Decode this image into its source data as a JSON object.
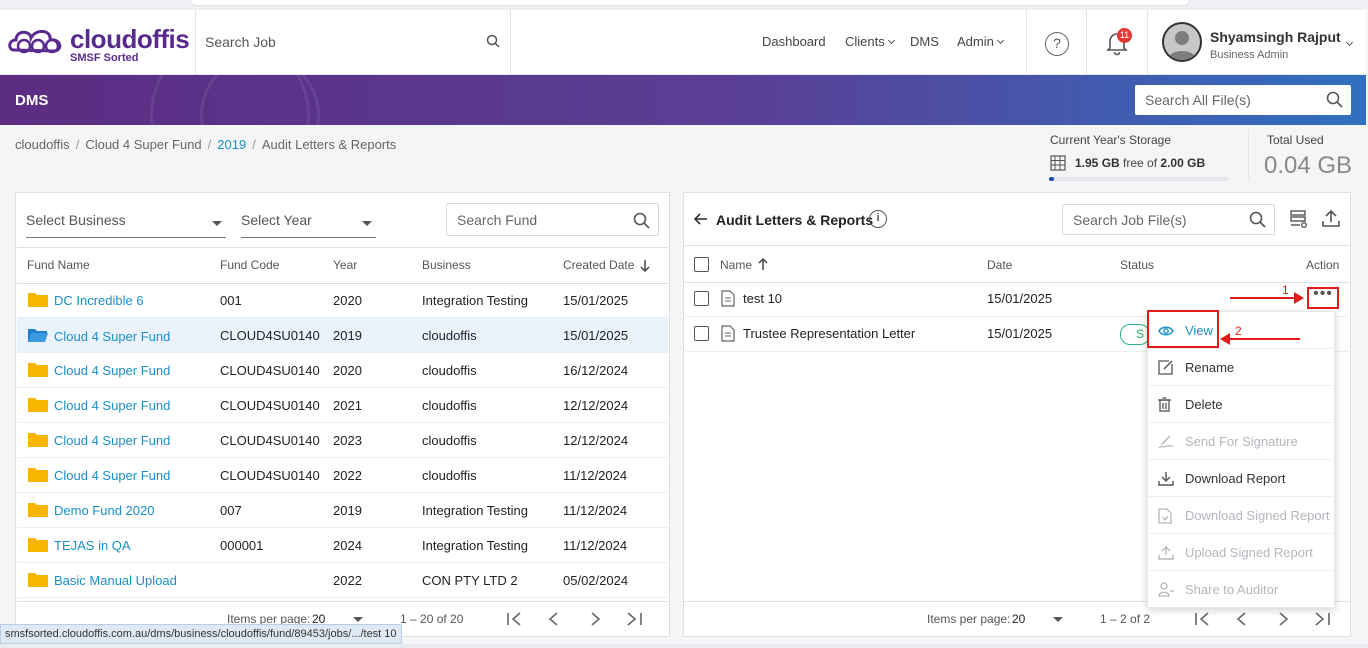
{
  "brand": {
    "name": "cloudoffis",
    "tagline": "SMSF Sorted",
    "color": "#5a2b8e"
  },
  "header": {
    "search_placeholder": "Search Job",
    "nav": [
      "Dashboard",
      "Clients",
      "DMS",
      "Admin"
    ],
    "notifications_count": "11",
    "user": {
      "name": "Shyamsingh Rajput",
      "role": "Business Admin"
    }
  },
  "banner": {
    "title": "DMS",
    "search_placeholder": "Search All File(s)"
  },
  "breadcrumb": [
    "cloudoffis",
    "Cloud 4 Super Fund",
    "2019",
    "Audit Letters & Reports"
  ],
  "storage": {
    "label": "Current Year's Storage",
    "free": "1.95 GB",
    "free_of": "free of",
    "total": "2.00 GB",
    "used_fraction": 0.025,
    "total_used_label": "Total Used",
    "total_used": "0.04 GB"
  },
  "left_panel": {
    "select_business": "Select Business",
    "select_year": "Select Year",
    "search_fund_placeholder": "Search Fund",
    "columns": [
      "Fund Name",
      "Fund Code",
      "Year",
      "Business",
      "Created Date"
    ],
    "rows": [
      {
        "name": "DC Incredible 6",
        "code": "001",
        "year": "2020",
        "business": "Integration Testing",
        "date": "15/01/2025"
      },
      {
        "name": "Cloud 4 Super Fund",
        "code": "CLOUD4SU0140",
        "year": "2019",
        "business": "cloudoffis",
        "date": "15/01/2025"
      },
      {
        "name": "Cloud 4 Super Fund",
        "code": "CLOUD4SU0140",
        "year": "2020",
        "business": "cloudoffis",
        "date": "16/12/2024"
      },
      {
        "name": "Cloud 4 Super Fund",
        "code": "CLOUD4SU0140",
        "year": "2021",
        "business": "cloudoffis",
        "date": "12/12/2024"
      },
      {
        "name": "Cloud 4 Super Fund",
        "code": "CLOUD4SU0140",
        "year": "2023",
        "business": "cloudoffis",
        "date": "12/12/2024"
      },
      {
        "name": "Cloud 4 Super Fund",
        "code": "CLOUD4SU0140",
        "year": "2022",
        "business": "cloudoffis",
        "date": "11/12/2024"
      },
      {
        "name": "Demo Fund 2020",
        "code": "007",
        "year": "2019",
        "business": "Integration Testing",
        "date": "11/12/2024"
      },
      {
        "name": "TEJAS in QA",
        "code": "000001",
        "year": "2024",
        "business": "Integration Testing",
        "date": "11/12/2024"
      },
      {
        "name": "Basic Manual Upload",
        "code": "",
        "year": "2022",
        "business": "CON PTY LTD 2",
        "date": "05/02/2024"
      }
    ],
    "pager": {
      "items_label": "Items per page:",
      "per_page": "20",
      "range": "1 – 20 of 20"
    }
  },
  "right_panel": {
    "title": "Audit Letters & Reports",
    "search_placeholder": "Search Job File(s)",
    "columns": [
      "Name",
      "Date",
      "Status",
      "Action"
    ],
    "rows": [
      {
        "name": "test 10",
        "date": "15/01/2025",
        "status": ""
      },
      {
        "name": "Trustee Representation Letter",
        "date": "15/01/2025",
        "status": "S"
      }
    ],
    "pager": {
      "items_label": "Items per page:",
      "per_page": "20",
      "range": "1 – 2 of 2"
    }
  },
  "action_menu": [
    "View",
    "Rename",
    "Delete",
    "Send For Signature",
    "Download Report",
    "Download Signed Report",
    "Upload Signed Report",
    "Share to Auditor"
  ],
  "annotations": [
    "1",
    "2"
  ],
  "status_url": "smsfsorted.cloudoffis.com.au/dms/business/cloudoffis/fund/89453/jobs/.../test 10",
  "colors": {
    "accent": "#1a8fc9",
    "highlight": "#e21b1b",
    "status_green": "#2db37a"
  }
}
